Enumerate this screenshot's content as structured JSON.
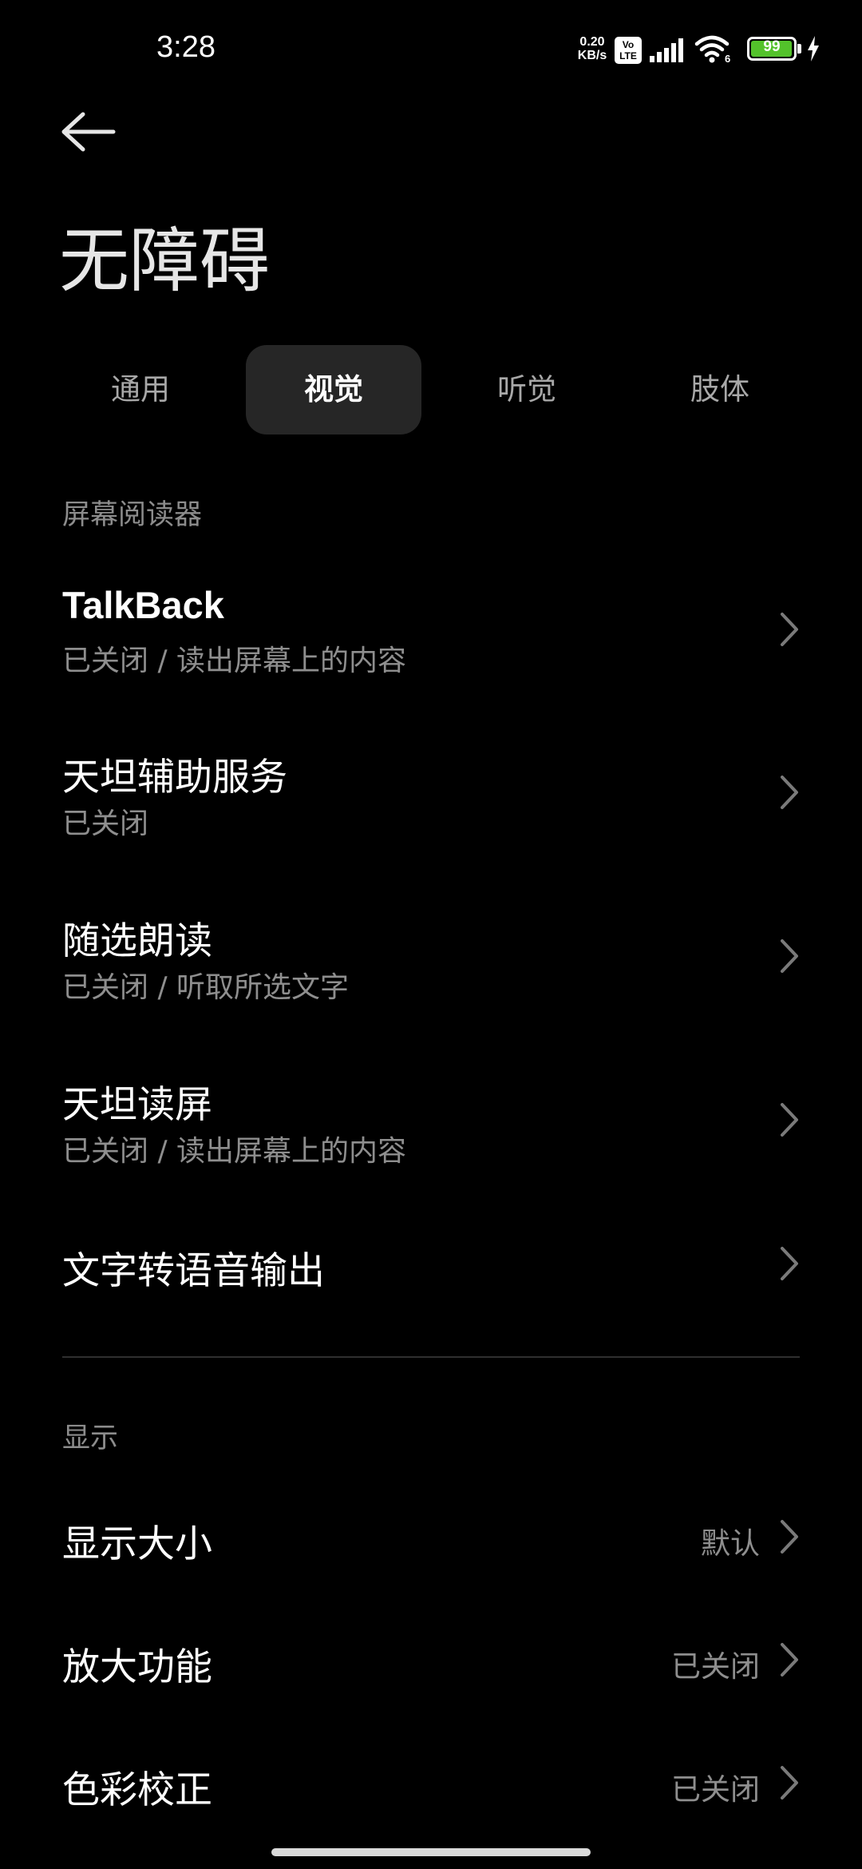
{
  "status_bar": {
    "time": "3:28",
    "net_speed_value": "0.20",
    "net_speed_unit": "KB/s",
    "volte_top": "Vo",
    "volte_bottom": "LTE",
    "wifi_label": "6",
    "battery_level": "99",
    "battery_color": "#53c22b"
  },
  "header": {
    "title": "无障碍"
  },
  "tabs": [
    {
      "label": "通用"
    },
    {
      "label": "视觉"
    },
    {
      "label": "听觉"
    },
    {
      "label": "肢体"
    }
  ],
  "active_tab": "视觉",
  "sections": {
    "screen_reader": {
      "header": "屏幕阅读器",
      "items": [
        {
          "title": "TalkBack",
          "subtitle": "已关闭 / 读出屏幕上的内容"
        },
        {
          "title": "天坦辅助服务",
          "subtitle": "已关闭"
        },
        {
          "title": "随选朗读",
          "subtitle": "已关闭 / 听取所选文字"
        },
        {
          "title": "天坦读屏",
          "subtitle": "已关闭 / 读出屏幕上的内容"
        },
        {
          "title": "文字转语音输出"
        }
      ]
    },
    "display": {
      "header": "显示",
      "items": [
        {
          "title": "显示大小",
          "value": "默认"
        },
        {
          "title": "放大功能",
          "value": "已关闭"
        },
        {
          "title": "色彩校正",
          "value": "已关闭"
        }
      ]
    }
  },
  "icons": {
    "back": "arrow-left-icon",
    "chevron": "chevron-right-icon"
  }
}
